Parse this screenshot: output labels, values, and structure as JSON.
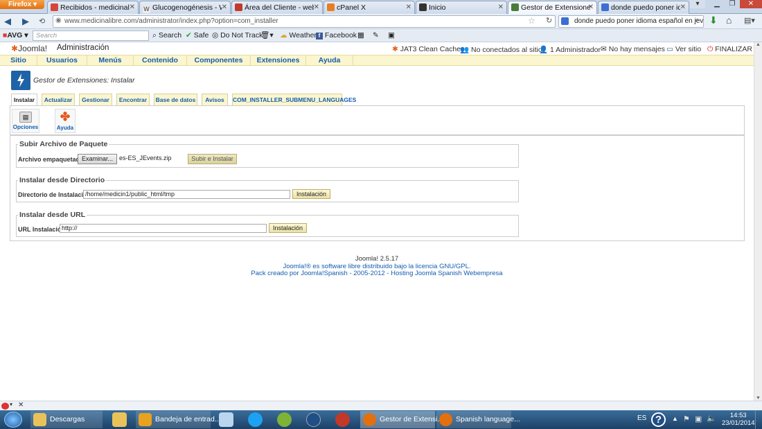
{
  "browser": {
    "menu_button": "Firefox",
    "tabs": [
      {
        "label": "Recibidos - medicinalibre....",
        "color": "#d44638"
      },
      {
        "label": "Glucogenogénesis - Wikip...",
        "color": "#777777"
      },
      {
        "label": "Área del Cliente - webemp...",
        "color": "#c0392b"
      },
      {
        "label": "cPanel X",
        "color": "#e67e22"
      },
      {
        "label": "Inicio",
        "color": "#333333"
      },
      {
        "label": "Gestor de Extensiones: Inst...",
        "color": "#4a7d3c"
      },
      {
        "label": "donde puedo poner idiom...",
        "color": "#3b6fd4"
      }
    ],
    "active_tab_index": 5,
    "url": "www.medicinalibre.com/administrator/index.php?option=com_installer",
    "search_text": "donde puedo poner idioma español en jevents"
  },
  "avg_toolbar": {
    "brand": "AVG",
    "search_placeholder": "Search",
    "search_button": "Search",
    "safe": "Safe",
    "do_not_track": "Do Not Track",
    "weather": "Weather",
    "facebook": "Facebook"
  },
  "joomla": {
    "logo_text": "Joomla!",
    "admin_label": "Administración",
    "status": {
      "cache": "JAT3 Clean Cache",
      "connected": "No conectados al sitio",
      "admins": "1 Administrador",
      "messages": "No hay mensajes",
      "view_site": "Ver sitio",
      "logout": "FINALIZAR"
    },
    "menu": [
      "Sitio",
      "Usuarios",
      "Menús",
      "Contenido",
      "Componentes",
      "Extensiones",
      "Ayuda"
    ],
    "page_title": "Gestor de Extensiones: Instalar",
    "subtabs": [
      "Instalar",
      "Actualizar",
      "Gestionar",
      "Encontrar",
      "Base de datos",
      "Avisos",
      "COM_INSTALLER_SUBMENU_LANGUAGES"
    ],
    "toolbar": {
      "options": "Opciones",
      "help": "Ayuda"
    },
    "upload": {
      "legend": "Subir Archivo de Paquete",
      "label": "Archivo empaquetado",
      "browse": "Examinar...",
      "file": "es-ES_JEvents.zip",
      "submit": "Subir e Instalar"
    },
    "directory": {
      "legend": "Instalar desde Directorio",
      "label": "Directorio de Instalación",
      "value": "/home/medicin1/public_html/tmp",
      "submit": "Instalación"
    },
    "url_install": {
      "legend": "Instalar desde URL",
      "label": "URL Instalación",
      "value": "http://",
      "submit": "Instalación"
    },
    "footer": {
      "version": "Joomla! 2.5.17",
      "license": "Joomla!® es software libre distribuido bajo la licencia GNU/GPL.",
      "pack": "Pack creado por Joomla!Spanish - 2005-2012 - Hosting Joomla Spanish Webempresa"
    }
  },
  "taskbar": {
    "apps": [
      {
        "label": "Descargas"
      },
      {
        "label": "Bandeja de entrad..."
      },
      {
        "label": "Gestor de Extensi..."
      },
      {
        "label": "Spanish language..."
      }
    ],
    "lang": "ES",
    "time": "14:53",
    "date": "23/01/2014"
  }
}
